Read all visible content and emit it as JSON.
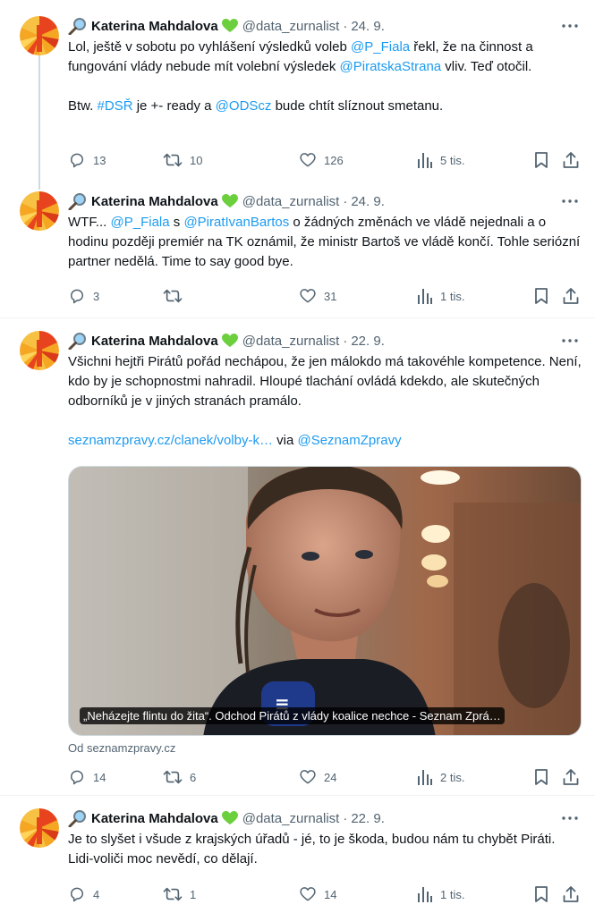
{
  "colors": {
    "link": "#1d9bf0",
    "muted": "#536471",
    "text": "#0f1419"
  },
  "author": {
    "name": "Katerina Mahdalova",
    "handle": "@data_zurnalist"
  },
  "tweets": [
    {
      "date": "24. 9.",
      "parts": [
        {
          "t": "Lol, ještě v sobotu po vyhlášení výsledků voleb "
        },
        {
          "t": "@P_Fiala",
          "link": true
        },
        {
          "t": "  řekl, že na činnost a fungování vlády nebude mít volební výsledek "
        },
        {
          "t": "@PiratskaStrana",
          "link": true
        },
        {
          "t": " vliv. Teď otočil."
        }
      ],
      "parts2": [
        {
          "t": "Btw. "
        },
        {
          "t": "#DSŘ",
          "link": true
        },
        {
          "t": " je +- ready a "
        },
        {
          "t": "@ODScz",
          "link": true
        },
        {
          "t": " bude chtít slíznout smetanu."
        }
      ],
      "replies": "13",
      "retweets": "10",
      "likes": "126",
      "views": "5 tis."
    },
    {
      "date": "24. 9.",
      "parts": [
        {
          "t": "WTF...  "
        },
        {
          "t": "@P_Fiala",
          "link": true
        },
        {
          "t": " s "
        },
        {
          "t": "@PiratIvanBartos",
          "link": true
        },
        {
          "t": " o žádných změnách ve vládě nejednali a o hodinu později premiér na TK oznámil, že ministr Bartoš ve vládě končí. Tohle seriózní partner nedělá. Time to say good bye."
        }
      ],
      "replies": "3",
      "retweets": "",
      "likes": "31",
      "views": "1 tis."
    },
    {
      "date": "22. 9.",
      "parts": [
        {
          "t": "Všichni hejtři Pirátů pořád nechápou, že jen málokdo má takovéhle kompetence. Není, kdo by je schopnostmi nahradil. Hloupé tlachání ovládá kdekdo, ale skutečných odborníků je v jiných stranách pramálo."
        }
      ],
      "parts2": [
        {
          "t": "seznamzpravy.cz/clanek/volby-k…",
          "link": true
        },
        {
          "t": " via "
        },
        {
          "t": "@SeznamZpravy",
          "link": true
        }
      ],
      "card_caption": "„Neházejte flintu do žita“. Odchod Pirátů z vlády koalice nechce - Seznam Zprá…",
      "card_source": "Od seznamzpravy.cz",
      "replies": "14",
      "retweets": "6",
      "likes": "24",
      "views": "2 tis."
    },
    {
      "date": "22. 9.",
      "parts": [
        {
          "t": "Je to slyšet i všude z krajských úřadů - jé, to je škoda, budou nám tu chybět Piráti. Lidi-voliči moc nevědí, co dělají."
        }
      ],
      "replies": "4",
      "retweets": "1",
      "likes": "14",
      "views": "1 tis."
    }
  ]
}
